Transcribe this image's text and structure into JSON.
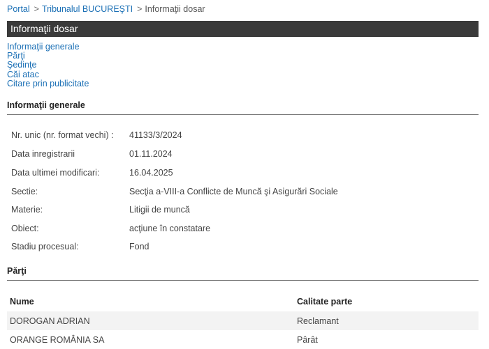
{
  "breadcrumb": {
    "portal": "Portal",
    "court": "Tribunalul BUCUREŞTI",
    "current": "Informaţii dosar",
    "separator": ">"
  },
  "title": "Informaţii dosar",
  "nav": {
    "general": "Informaţii generale",
    "parties": "Părţi",
    "hearings": "Şedinţe",
    "appeals": "Căi atac",
    "summons": "Citare prin publicitate"
  },
  "general_section": {
    "heading": "Informaţii generale",
    "rows": [
      {
        "label": "Nr. unic (nr. format vechi) :",
        "value": "41133/3/2024"
      },
      {
        "label": "Data inregistrarii",
        "value": "01.11.2024"
      },
      {
        "label": "Data ultimei modificari:",
        "value": "16.04.2025"
      },
      {
        "label": "Sectie:",
        "value": "Secţia a-VIII-a Conflicte de Muncă şi Asigurări Sociale"
      },
      {
        "label": "Materie:",
        "value": "Litigii de muncă"
      },
      {
        "label": "Obiect:",
        "value": "acţiune în constatare"
      },
      {
        "label": "Stadiu procesual:",
        "value": "Fond"
      }
    ]
  },
  "parties_section": {
    "heading": "Părţi",
    "columns": {
      "name": "Nume",
      "role": "Calitate parte"
    },
    "rows": [
      {
        "name": "DOROGAN ADRIAN",
        "role": "Reclamant"
      },
      {
        "name": "ORANGE ROMÂNIA SA",
        "role": "Pârât"
      }
    ]
  },
  "colors": {
    "link": "#1a6fb5",
    "titlebar_bg": "#3a3a3a",
    "titlebar_text": "#ffffff",
    "row_alt_bg": "#f3f3f3"
  }
}
